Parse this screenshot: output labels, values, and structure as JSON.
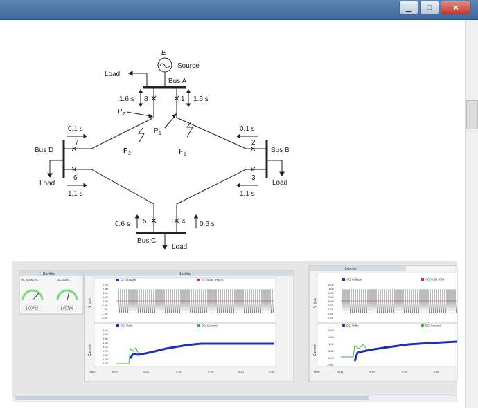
{
  "window": {
    "minimize_glyph": "▁",
    "maximize_glyph": "□",
    "close_glyph": "✕"
  },
  "diagram": {
    "source_label": "Source",
    "e_label": "E",
    "bus_a": "Bus  A",
    "bus_b": "Bus  B",
    "bus_c": "Bus  C",
    "bus_d": "Bus  D",
    "load_a": "Load",
    "load_b": "Load",
    "load_c": "Load",
    "load_d": "Load",
    "breaker_1": "1",
    "breaker_2": "2",
    "breaker_3": "3",
    "breaker_4": "4",
    "breaker_5": "5",
    "breaker_6": "6",
    "breaker_7": "7",
    "breaker_8": "8",
    "t_8": "1.6 s",
    "t_1": "1.6 s",
    "t_7": "0.1 s",
    "t_2": "0.1 s",
    "t_6": "1.1 s",
    "t_3": "1.1 s",
    "t_5": "0.6 s",
    "t_4": "0.6 s",
    "p2": "P",
    "p2_sub": "2",
    "p1": "P",
    "p1_sub": "1",
    "f2": "F",
    "f2_sub": "2",
    "f1": "F",
    "f1_sub": "1"
  },
  "rectifier": {
    "title": "Rectifier",
    "meter1_label": "AC Volts (R...",
    "meter2_label": "DC Volts",
    "meter1_value": "1.00702",
    "meter2_value": "1.05724",
    "ac_plot_title": "Rectifier",
    "ac_legend_1": "AC Voltage",
    "ac_legend_2": "AC Volts (RMS)",
    "ac_ylabel": "V (pu)",
    "ac_ticks": [
      "2.00",
      "1.50",
      "1.00",
      "0.50",
      "0.00",
      "-0.50",
      "-1.00",
      "-1.50",
      "-2.00"
    ],
    "dc_legend_1": "DC Volts",
    "dc_legend_2": "DC Current",
    "dc_ylabel": "Current",
    "dc_ticks": [
      "2.00",
      "1.75",
      "1.50",
      "1.25",
      "1.00",
      "0.75",
      "0.50",
      "0.25",
      "0.00"
    ],
    "time_label": "Time",
    "time_ticks": [
      "0.00",
      "0.10",
      "0.20",
      "0.30",
      "0.40",
      "0.50"
    ]
  },
  "inverter": {
    "title": "Inverter",
    "ac_legend_1": "AC Voltage",
    "ac_legend_2": "AC Volts (RM",
    "ac_ylabel": "V (pu)",
    "ac_ticks": [
      "2.00",
      "1.50",
      "1.00",
      "0.50",
      "0.00",
      "-0.50",
      "-1.00",
      "-1.50",
      "-2.00"
    ],
    "dc_legend_1": "DC Volts",
    "dc_legend_2": "DC Current",
    "dc_ylabel": "Current",
    "dc_ticks": [
      "2.00",
      "1.50",
      "1.00",
      "0.50",
      "0.00",
      "-0.50"
    ],
    "time_label": "Time",
    "time_ticks": [
      "0.00",
      "0.10",
      "0.20",
      "0.30"
    ]
  },
  "colors": {
    "titlebar": "#4a74a6",
    "dc_volts": "#1f2fb0",
    "dc_current": "#3bb53b",
    "ac_rms": "#c0392b"
  }
}
